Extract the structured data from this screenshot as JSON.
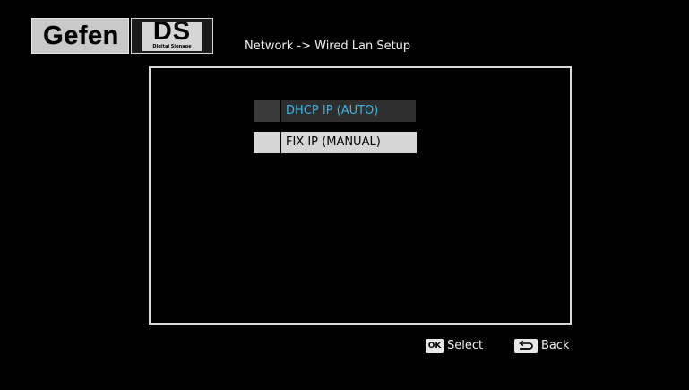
{
  "logo": {
    "brand": "Gefen",
    "product": "DS",
    "product_sub": "Digital Signage"
  },
  "header": {
    "title": "Network -> Wired Lan Setup"
  },
  "menu": {
    "items": [
      {
        "label": "DHCP IP (AUTO)",
        "state": "selected"
      },
      {
        "label": "FIX IP (MANUAL)",
        "state": "normal"
      }
    ]
  },
  "footer": {
    "select_key": "OK",
    "select_label": "Select",
    "back_key_icon": "return-arrow-icon",
    "back_label": "Back"
  },
  "colors": {
    "background": "#000000",
    "highlight_text": "#39b4e8",
    "item_background": "#d6d6d6"
  }
}
